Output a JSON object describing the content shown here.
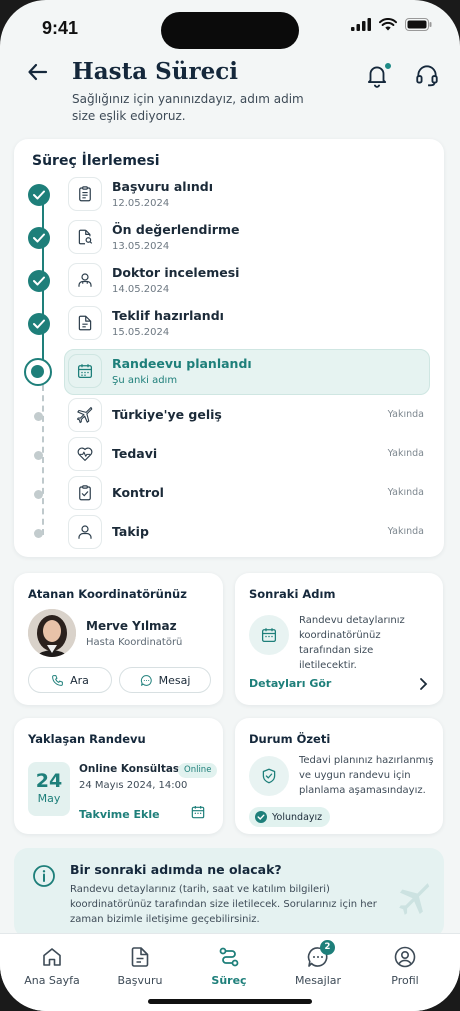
{
  "status_bar": {
    "time": "9:41"
  },
  "header": {
    "title": "Hasta Süreci",
    "subtitle": "Sağlığınız için yanınızdayız, adım adim size eşlik ediyoruz."
  },
  "progress": {
    "title": "Süreç İlerlemesi",
    "steps": [
      {
        "name": "Başvuru alındı",
        "date": "12.05.2024",
        "state": "done",
        "icon": "clipboard-icon"
      },
      {
        "name": "Ön değerlendirme",
        "date": "13.05.2024",
        "state": "done",
        "icon": "document-search-icon"
      },
      {
        "name": "Doktor incelemesi",
        "date": "14.05.2024",
        "state": "done",
        "icon": "doctor-icon"
      },
      {
        "name": "Teklif hazırlandı",
        "date": "15.05.2024",
        "state": "done",
        "icon": "document-icon"
      },
      {
        "name": "Randeevu planlandı",
        "date": "Şu anki adım",
        "state": "current",
        "icon": "calendar-icon"
      },
      {
        "name": "Türkiye'ye geliş",
        "soon": "Yakında",
        "state": "upcoming",
        "icon": "plane-icon"
      },
      {
        "name": "Tedavi",
        "soon": "Yakında",
        "state": "upcoming",
        "icon": "heart-pulse-icon"
      },
      {
        "name": "Kontrol",
        "soon": "Yakında",
        "state": "upcoming",
        "icon": "clipboard-check-icon"
      },
      {
        "name": "Takip",
        "soon": "Yakında",
        "state": "upcoming",
        "icon": "person-icon"
      }
    ]
  },
  "coordinator": {
    "title": "Atanan Koordinatörünüz",
    "name": "Merve Yılmaz",
    "role": "Hasta Koordinatörü",
    "call_label": "Ara",
    "message_label": "Mesaj"
  },
  "next_step": {
    "title": "Sonraki Adım",
    "text": "Randevu detaylarınız koordinatörünüz tarafından size iletilecektir.",
    "link": "Detayları Gör"
  },
  "appointment": {
    "title": "Yaklaşan Randevu",
    "day": "24",
    "month": "May",
    "name": "Online Konsültasyon",
    "badge": "Online",
    "datetime": "24 Mayıs 2024, 14:00",
    "add_label": "Takvime Ekle"
  },
  "status_summary": {
    "title": "Durum Özeti",
    "text": "Tedavi planınız hazırlanmış ve uygun randevu için planlama aşamasındayız.",
    "badge": "Yolundayız"
  },
  "info": {
    "title": "Bir sonraki adımda ne olacak?",
    "text": "Randevu detaylarınız (tarih, saat ve katılım bilgileri) koordinatörünüz tarafından size iletilecek. Sorularınız için her zaman bizimle iletişime geçebilirsiniz."
  },
  "tabs": [
    {
      "label": "Ana Sayfa",
      "icon": "home-icon"
    },
    {
      "label": "Başvuru",
      "icon": "document-icon"
    },
    {
      "label": "Süreç",
      "icon": "route-icon",
      "active": true
    },
    {
      "label": "Mesajlar",
      "icon": "chat-icon",
      "badge": "2"
    },
    {
      "label": "Profil",
      "icon": "profile-icon"
    }
  ],
  "colors": {
    "accent": "#1e7f7a",
    "accent_light": "#e6f3f1",
    "background": "#f3f6f6"
  }
}
